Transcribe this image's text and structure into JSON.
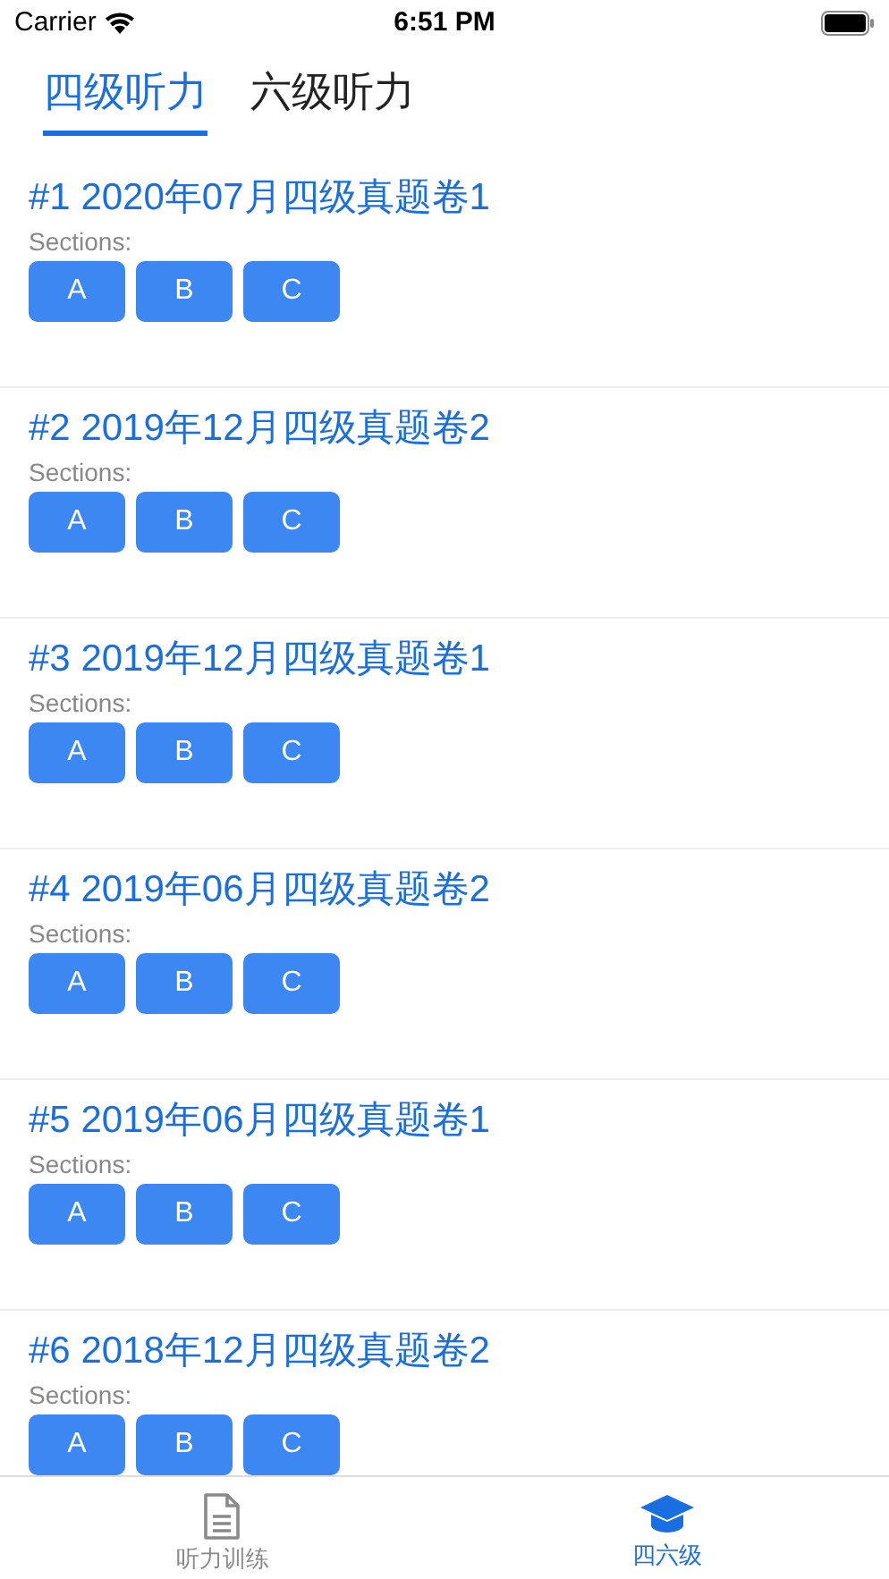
{
  "status_bar": {
    "carrier": "Carrier",
    "time": "6:51 PM"
  },
  "tabs": [
    {
      "label": "四级听力",
      "selected": true
    },
    {
      "label": "六级听力",
      "selected": false
    }
  ],
  "papers": [
    {
      "title": "#1 2020年07月四级真题卷1",
      "sections_label": "Sections:",
      "sections": [
        "A",
        "B",
        "C"
      ]
    },
    {
      "title": "#2 2019年12月四级真题卷2",
      "sections_label": "Sections:",
      "sections": [
        "A",
        "B",
        "C"
      ]
    },
    {
      "title": "#3 2019年12月四级真题卷1",
      "sections_label": "Sections:",
      "sections": [
        "A",
        "B",
        "C"
      ]
    },
    {
      "title": "#4 2019年06月四级真题卷2",
      "sections_label": "Sections:",
      "sections": [
        "A",
        "B",
        "C"
      ]
    },
    {
      "title": "#5 2019年06月四级真题卷1",
      "sections_label": "Sections:",
      "sections": [
        "A",
        "B",
        "C"
      ]
    },
    {
      "title": "#6 2018年12月四级真题卷2",
      "sections_label": "Sections:",
      "sections": [
        "A",
        "B",
        "C"
      ]
    }
  ],
  "tab_bar": [
    {
      "kind": "document",
      "label": "听力训练",
      "selected": false
    },
    {
      "kind": "cap",
      "label": "四六级",
      "selected": true
    }
  ]
}
